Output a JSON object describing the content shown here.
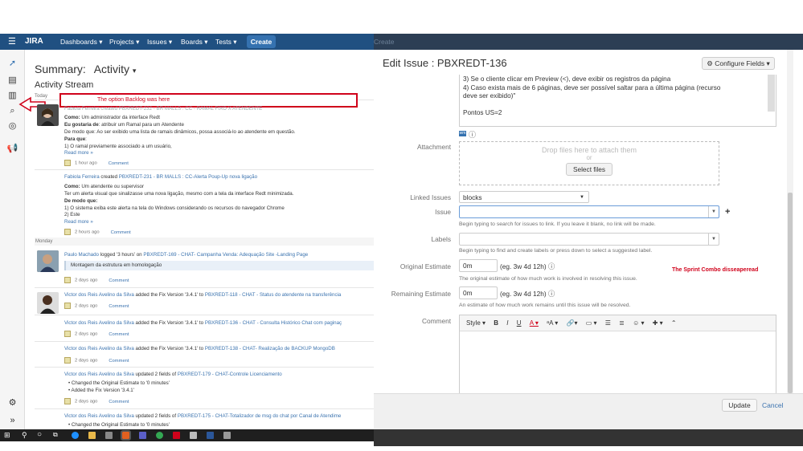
{
  "jira": {
    "logo": "JIRA",
    "nav": [
      "Dashboards ▾",
      "Projects ▾",
      "Issues ▾",
      "Boards ▾",
      "Tests ▾"
    ],
    "create": "Create"
  },
  "summary": {
    "label": "Summary:",
    "value": "Activity",
    "caret": "▾"
  },
  "stream_title": "Activity Stream",
  "day_today": "Today",
  "day_monday": "Monday",
  "annotation_backlog": "The option Backlog was here",
  "annotation_sprint": "The Sprint Combo disseaperead",
  "a1": {
    "header": "Fabiola Ferreira created PBXREDT-232 - BR MALLS : CC - RAMAL FIXO X ATENDENTE",
    "l1_b": "Como:",
    "l1": " Um administrador da interface Redt",
    "l2_b": "Eu gostaria de",
    "l2": ": atribuir um Ramal para um Atendente",
    "l3": "De modo que: Ao ser exibido uma lista de ramais dinâmicos, possa associá-lo ao atendente em questão.",
    "l4_b": "Para que",
    "l5": "1) O ramal previamente associado a um usuário,",
    "more": "Read more »",
    "time": "1 hour ago",
    "comment": "Comment"
  },
  "a2": {
    "user": "Fabiola Ferreira",
    "action": " created ",
    "issue": "PBXREDT-231 - BR MALLS : CC-Alerta Poup-Up nova ligação",
    "l1_b": "Como:",
    "l1": " Um atendente ou supervisor",
    "l2": "Ter um alerta visual que sinalizasse uma nova ligação, mesmo com a tela da interface Redt minimizada.",
    "l3_b": "De modo que:",
    "l4": "1) O sistema exiba este alerta na tela do Windows considerando os recursos do navegador Chrome",
    "l5": "2) Este",
    "more": "Read more »",
    "time": "2 hours ago",
    "comment": "Comment"
  },
  "a3": {
    "user": "Paulo Machado",
    "action": " logged '3 hours' on ",
    "issue": "PBXREDT-169 - CHAT- Campanha Venda: Adequação Site -Landing Page",
    "note": "Montagem da estrutura em homologação",
    "time": "2 days ago",
    "comment": "Comment"
  },
  "a4": {
    "user": "Victor dos Reis Avelino da Silva",
    "action": " added the Fix Version '3.4.1' to ",
    "issue": "PBXREDT-118 - CHAT - Status do atendente na transferência",
    "time": "2 days ago",
    "comment": "Comment"
  },
  "a5": {
    "user": "Victor dos Reis Avelino da Silva",
    "action": " added the Fix Version '3.4.1' to ",
    "issue": "PBXREDT-136 - CHAT - Consulta Histórico Chat com paginaç",
    "time": "2 days ago",
    "comment": "Comment"
  },
  "a6": {
    "user": "Victor dos Reis Avelino da Silva",
    "action": " added the Fix Version '3.4.1' to ",
    "issue": "PBXREDT-138 - CHAT- Realização de BACKUP MongoDB",
    "time": "2 days ago",
    "comment": "Comment"
  },
  "a7": {
    "user": "Victor dos Reis Avelino da Silva",
    "action": " updated 2 fields of ",
    "issue": "PBXREDT-179 - CHAT-Controle Licenciamento",
    "b1": "Changed the Original Estimate to '0 minutes'",
    "b2": "Added the Fix Version '3.4.1'",
    "time": "2 days ago",
    "comment": "Comment"
  },
  "a8": {
    "user": "Victor dos Reis Avelino da Silva",
    "action": " updated 2 fields of ",
    "issue": "PBXREDT-175 - CHAT-Totalizador de msg do chat por Canal de Atendime",
    "b1": "Changed the Original Estimate to '0 minutes'"
  },
  "edit": {
    "ghost_create": "Create",
    "title": "Edit Issue : PBXREDT-136",
    "configure": "Configure Fields ▾",
    "desc_lines": [
      "3) Se o cliente clicar em Preview (<), deve exibir os registros da página",
      "4) Caso exista mais de 6 páginas, deve ser possível saltar para a última página (recurso",
      "deve ser  exibido)\"",
      "",
      "Pontos US=2"
    ],
    "attachment_label": "Attachment",
    "drop_text": "Drop files here to attach them",
    "or_text": "or",
    "select_files": "Select files",
    "linked_label": "Linked Issues",
    "linked_value": "blocks",
    "issue_label": "Issue",
    "issue_hint": "Begin typing to search for issues to link. If you leave it blank, no link will be made.",
    "labels_label": "Labels",
    "labels_hint": "Begin typing to find and create labels or press down to select a suggested label.",
    "orig_label": "Original Estimate",
    "orig_value": "0m",
    "orig_eg": "(eg. 3w 4d 12h)",
    "orig_hint": "The original estimate of how much work is involved in resolving this issue.",
    "rem_label": "Remaining Estimate",
    "rem_value": "0m",
    "rem_eg": "(eg. 3w 4d 12h)",
    "rem_hint": "An estimate of how much work remains until this issue will be resolved.",
    "comment_label": "Comment",
    "style": "Style ▾",
    "update": "Update",
    "cancel": "Cancel"
  },
  "colors": {
    "jira_blue": "#205081",
    "annotation_red": "#d0021b",
    "link": "#3b73af"
  }
}
